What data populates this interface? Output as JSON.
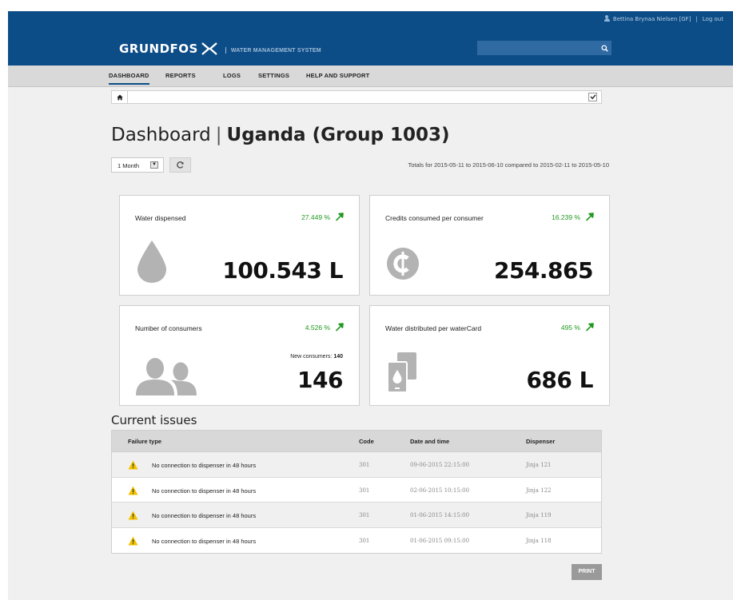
{
  "header": {
    "user_name": "Bettina Brynaa Nielsen [GF]",
    "separator": "|",
    "logout": "Log out",
    "brand": "GRUNDFOS",
    "subtitle": "WATER MANAGEMENT SYSTEM",
    "search": {
      "value": "",
      "placeholder": ""
    },
    "brand_color": "#0d4d87"
  },
  "nav": {
    "items": [
      {
        "label": "DASHBOARD",
        "active": true
      },
      {
        "label": "REPORTS",
        "active": false
      },
      {
        "label": "LOGS",
        "active": false
      },
      {
        "label": "SETTINGS",
        "active": false
      },
      {
        "label": "HELP AND SUPPORT",
        "active": false
      }
    ]
  },
  "breadcrumb": {
    "home_icon": "home-icon",
    "checkbox_checked": true
  },
  "page": {
    "title": "Dashboard",
    "separator": "|",
    "group": "Uganda (Group 1003)",
    "period": "1 Month",
    "totals": "Totals for 2015-05-11 to 2015-06-10 compared to 2015-02-11 to 2015-05-10"
  },
  "cards": [
    {
      "label": "Water dispensed",
      "delta": "27.449 %",
      "value": "100.543 L",
      "icon": "water-drop-icon",
      "trend": "up"
    },
    {
      "label": "Credits consumed per consumer",
      "delta": "16.239 %",
      "value": "254.865",
      "icon": "credit-coin-icon",
      "trend": "up"
    },
    {
      "label": "Number of consumers",
      "delta": "4.526 %",
      "value": "146",
      "extra_label": "New consumers:",
      "extra_value": "140",
      "icon": "consumers-icon",
      "trend": "up"
    },
    {
      "label": "Water distributed per waterCard",
      "delta": "495 %",
      "value": "686 L",
      "icon": "watercard-icon",
      "trend": "up"
    }
  ],
  "issues": {
    "title": "Current issues",
    "columns": [
      "Failure type",
      "Code",
      "Date and time",
      "Dispenser"
    ],
    "rows": [
      {
        "failure": "No connection to dispenser in 48 hours",
        "code": "301",
        "datetime": "09-06-2015 22:15:00",
        "dispenser": "Jinja 121"
      },
      {
        "failure": "No connection to dispenser in 48 hours",
        "code": "301",
        "datetime": "02-06-2015 10:15:00",
        "dispenser": "Jinja 122"
      },
      {
        "failure": "No connection to dispenser in 48 hours",
        "code": "301",
        "datetime": "01-06-2015 14:15:00",
        "dispenser": "Jinja 119"
      },
      {
        "failure": "No connection to dispenser in 48 hours",
        "code": "301",
        "datetime": "01-06-2015 09:15:00",
        "dispenser": "Jinja 118"
      }
    ]
  },
  "print_label": "PRINT",
  "colors": {
    "trend_up": "#1f9a1f",
    "icon_gray": "#b3b3b3",
    "warning": "#f2c200"
  }
}
